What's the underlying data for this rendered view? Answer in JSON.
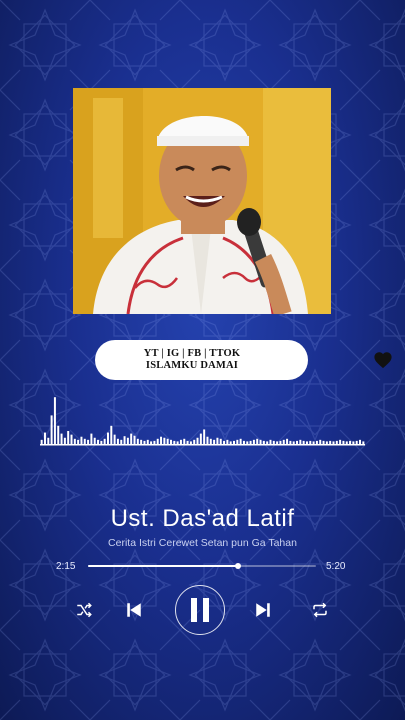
{
  "cover": {
    "image": "speaker-portrait",
    "background": "#e6b22a"
  },
  "channel_pill": {
    "line1": "YT | IG | FB | TTOK",
    "line2": "ISLAMKU DAMAI",
    "icon": "heart-icon"
  },
  "track": {
    "title": "Ust. Das'ad Latif",
    "subtitle": "Cerita Istri Cerewet Setan pun Ga Tahan",
    "current_time": "2:15",
    "total_time": "5:20",
    "progress": 0.66
  },
  "controls": {
    "shuffle": "shuffle-icon",
    "previous": "skip-previous-icon",
    "play_pause": "pause-icon",
    "next": "skip-next-icon",
    "repeat": "repeat-icon"
  },
  "colors": {
    "background": "#1a2f8f",
    "accent": "#ffffff"
  },
  "waveform": [
    0.08,
    0.22,
    0.12,
    0.55,
    0.9,
    0.35,
    0.2,
    0.12,
    0.25,
    0.18,
    0.1,
    0.08,
    0.14,
    0.1,
    0.08,
    0.2,
    0.12,
    0.08,
    0.06,
    0.1,
    0.22,
    0.35,
    0.18,
    0.1,
    0.08,
    0.15,
    0.12,
    0.2,
    0.16,
    0.1,
    0.08,
    0.06,
    0.08,
    0.05,
    0.06,
    0.1,
    0.14,
    0.12,
    0.1,
    0.08,
    0.06,
    0.05,
    0.08,
    0.1,
    0.06,
    0.05,
    0.08,
    0.12,
    0.2,
    0.28,
    0.14,
    0.1,
    0.08,
    0.12,
    0.1,
    0.06,
    0.08,
    0.05,
    0.06,
    0.08,
    0.1,
    0.06,
    0.05,
    0.06,
    0.08,
    0.1,
    0.08,
    0.06,
    0.05,
    0.08,
    0.06,
    0.05,
    0.06,
    0.08,
    0.1,
    0.06,
    0.05,
    0.06,
    0.08,
    0.06,
    0.05,
    0.06,
    0.05,
    0.06,
    0.08,
    0.06,
    0.05,
    0.06,
    0.05,
    0.06,
    0.08,
    0.06,
    0.05,
    0.06,
    0.05,
    0.06,
    0.08,
    0.05
  ]
}
